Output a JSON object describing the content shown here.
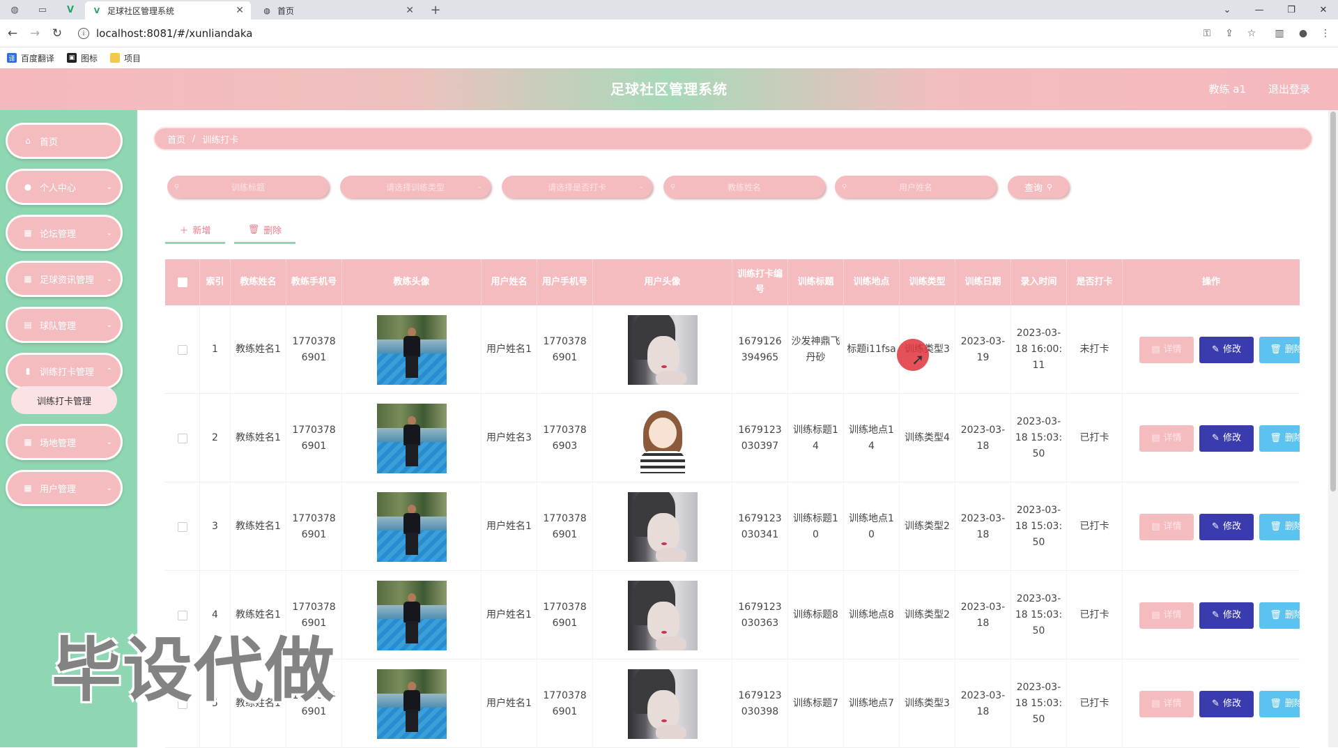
{
  "browser": {
    "tabs": [
      {
        "title": "足球社区管理系统",
        "active": true
      },
      {
        "title": "首页",
        "active": false
      }
    ],
    "new_tab": "+",
    "url": "localhost:8081/#/xunliandaka",
    "bookmarks": [
      "百度翻译",
      "图标",
      "项目"
    ]
  },
  "header": {
    "title": "足球社区管理系统",
    "user": "教练 a1",
    "logout": "退出登录"
  },
  "sidebar": {
    "items": [
      {
        "label": "首页",
        "icon": "home-icon"
      },
      {
        "label": "个人中心",
        "icon": "user-icon"
      },
      {
        "label": "论坛管理",
        "icon": "grid-icon"
      },
      {
        "label": "足球资讯管理",
        "icon": "grid-icon"
      },
      {
        "label": "球队管理",
        "icon": "clipboard-icon"
      },
      {
        "label": "训练打卡管理",
        "icon": "bar-chart-icon"
      },
      {
        "label": "场地管理",
        "icon": "grid-icon"
      },
      {
        "label": "用户管理",
        "icon": "grid-icon"
      }
    ],
    "sub_item": "训练打卡管理"
  },
  "breadcrumb": {
    "home": "首页",
    "sep": "/",
    "current": "训练打卡"
  },
  "filters": {
    "title_placeholder": "训练标题",
    "type_placeholder": "请选择训练类型",
    "checkin_placeholder": "请选择是否打卡",
    "coach_placeholder": "教练姓名",
    "user_placeholder": "用户姓名",
    "query": "查询"
  },
  "actions": {
    "add": "新增",
    "delete": "删除"
  },
  "table": {
    "columns": [
      "索引",
      "教练姓名",
      "教练手机号",
      "教练头像",
      "用户姓名",
      "用户手机号",
      "用户头像",
      "训练打卡编号",
      "训练标题",
      "训练地点",
      "训练类型",
      "训练日期",
      "录入时间",
      "是否打卡",
      "操作"
    ],
    "op_labels": {
      "detail": "详情",
      "edit": "修改",
      "delete": "删除"
    },
    "rows": [
      {
        "index": "1",
        "coach": "教练姓名1",
        "coach_phone": "17703786901",
        "user": "用户姓名1",
        "user_phone": "17703786901",
        "avatar": "photo",
        "code": "1679126394965",
        "title": "沙发神鼎飞丹砂",
        "place": "标题i11fsa",
        "type": "训练类型3",
        "date": "2023-03-19",
        "created": "2023-03-18 16:00:11",
        "checked": "未打卡"
      },
      {
        "index": "2",
        "coach": "教练姓名1",
        "coach_phone": "17703786901",
        "user": "用户姓名3",
        "user_phone": "17703786903",
        "avatar": "cartoon",
        "code": "1679123030397",
        "title": "训练标题14",
        "place": "训练地点14",
        "type": "训练类型4",
        "date": "2023-03-18",
        "created": "2023-03-18 15:03:50",
        "checked": "已打卡"
      },
      {
        "index": "3",
        "coach": "教练姓名1",
        "coach_phone": "17703786901",
        "user": "用户姓名1",
        "user_phone": "17703786901",
        "avatar": "photo",
        "code": "1679123030341",
        "title": "训练标题10",
        "place": "训练地点10",
        "type": "训练类型2",
        "date": "2023-03-18",
        "created": "2023-03-18 15:03:50",
        "checked": "已打卡"
      },
      {
        "index": "4",
        "coach": "教练姓名1",
        "coach_phone": "17703786901",
        "user": "用户姓名1",
        "user_phone": "17703786901",
        "avatar": "photo",
        "code": "1679123030363",
        "title": "训练标题8",
        "place": "训练地点8",
        "type": "训练类型2",
        "date": "2023-03-18",
        "created": "2023-03-18 15:03:50",
        "checked": "已打卡"
      },
      {
        "index": "5",
        "coach": "教练姓名1",
        "coach_phone": "17703786901",
        "user": "用户姓名1",
        "user_phone": "17703786901",
        "avatar": "photo",
        "code": "1679123030398",
        "title": "训练标题7",
        "place": "训练地点7",
        "type": "训练类型3",
        "date": "2023-03-18",
        "created": "2023-03-18 15:03:50",
        "checked": "已打卡"
      }
    ]
  },
  "watermark": "毕设代做",
  "colors": {
    "primary": "#f5bcc0",
    "sidebar": "#8fd7b2",
    "edit": "#3b3bb0",
    "delete": "#5cc3f0"
  }
}
